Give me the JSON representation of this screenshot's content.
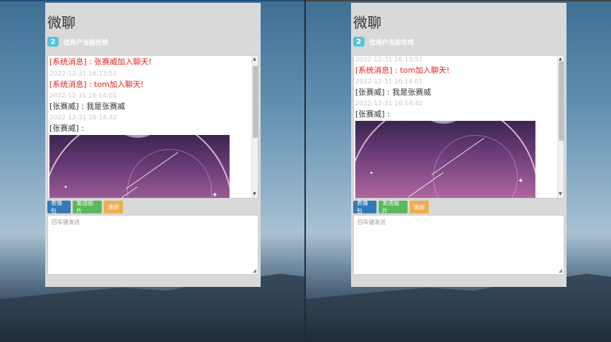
{
  "app": {
    "title": "微聊"
  },
  "online": {
    "count": "2",
    "label": "位用户当前在线"
  },
  "buttons": {
    "emoji": "表情包",
    "send_image": "发送图片",
    "clear": "清屏"
  },
  "input": {
    "placeholder": "回车键发送"
  },
  "left": {
    "messages": [
      {
        "type": "system",
        "text": "[系统消息] : 张赛威加入聊天!"
      },
      {
        "type": "timestamp",
        "text": "2022-12-31 16:13:51"
      },
      {
        "type": "system",
        "text": "[系统消息] : tom加入聊天!"
      },
      {
        "type": "timestamp",
        "text": "2022-12-31 16:14:01"
      },
      {
        "type": "user",
        "text": "[张赛威] : 我是张赛威"
      },
      {
        "type": "timestamp",
        "text": "2022-12-31 16:14:42"
      },
      {
        "type": "user",
        "text": "[张赛威] :"
      }
    ]
  },
  "right": {
    "messages": [
      {
        "type": "timestamp",
        "text": "2022-12-31 16:13:51"
      },
      {
        "type": "system",
        "text": "[系统消息] : tom加入聊天!"
      },
      {
        "type": "timestamp",
        "text": "2022-12-31 16:14:01"
      },
      {
        "type": "user",
        "text": "[张赛威] : 我是张赛威"
      },
      {
        "type": "timestamp",
        "text": "2022-12-31 16:14:42"
      },
      {
        "type": "user",
        "text": "[张赛威] :"
      }
    ]
  },
  "colors": {
    "system": "#e02020",
    "badge": "#5bc0de",
    "primary": "#337ab7",
    "success": "#5cb85c",
    "warning": "#f0ad4e"
  }
}
